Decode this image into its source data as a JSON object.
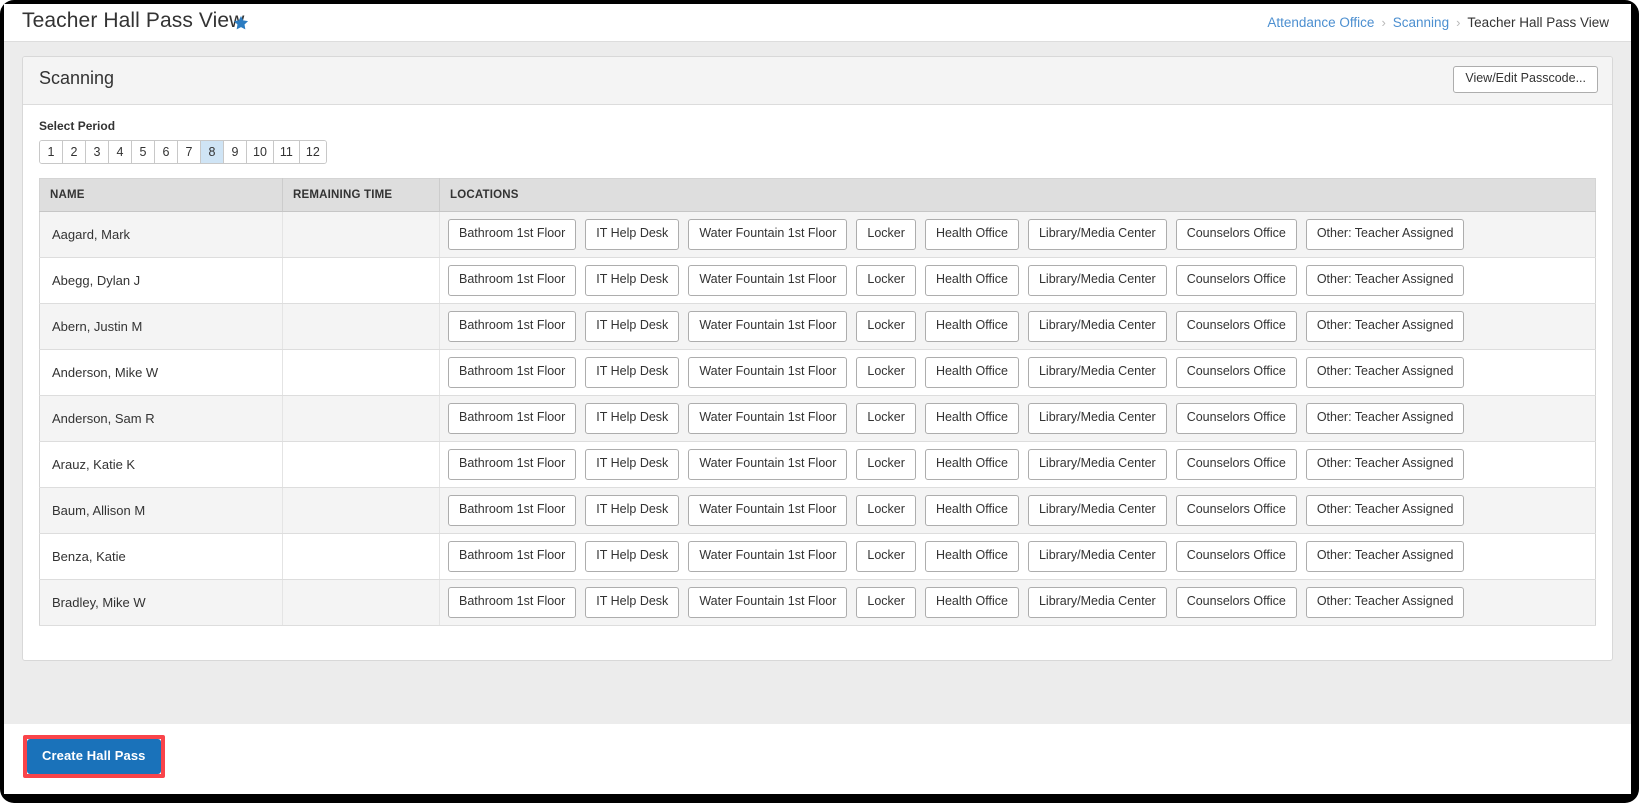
{
  "header": {
    "title": "Teacher Hall Pass View",
    "favorite_icon": "star-icon",
    "star_color": "#2b7cc1"
  },
  "breadcrumb": {
    "items": [
      {
        "label": "Attendance Office",
        "link": true
      },
      {
        "label": "Scanning",
        "link": true
      },
      {
        "label": "Teacher Hall Pass View",
        "link": false
      }
    ],
    "separator": "›"
  },
  "card": {
    "title": "Scanning",
    "passcode_button": "View/Edit Passcode..."
  },
  "period_selector": {
    "label": "Select Period",
    "options": [
      "1",
      "2",
      "3",
      "4",
      "5",
      "6",
      "7",
      "8",
      "9",
      "10",
      "11",
      "12"
    ],
    "selected": "8",
    "selected_color": "#cfe4f5"
  },
  "table": {
    "columns": [
      "NAME",
      "REMAINING TIME",
      "LOCATIONS"
    ],
    "locations": [
      "Bathroom 1st Floor",
      "IT Help Desk",
      "Water Fountain 1st Floor",
      "Locker",
      "Health Office",
      "Library/Media Center",
      "Counselors Office",
      "Other: Teacher Assigned"
    ],
    "rows": [
      {
        "name": "Aagard, Mark",
        "remaining_time": ""
      },
      {
        "name": "Abegg, Dylan J",
        "remaining_time": ""
      },
      {
        "name": "Abern, Justin M",
        "remaining_time": ""
      },
      {
        "name": "Anderson, Mike W",
        "remaining_time": ""
      },
      {
        "name": "Anderson, Sam R",
        "remaining_time": ""
      },
      {
        "name": "Arauz, Katie K",
        "remaining_time": ""
      },
      {
        "name": "Baum, Allison M",
        "remaining_time": ""
      },
      {
        "name": "Benza, Katie",
        "remaining_time": ""
      },
      {
        "name": "Bradley, Mike W",
        "remaining_time": ""
      }
    ]
  },
  "footer": {
    "create_button": "Create Hall Pass",
    "create_button_color": "#1a72ba",
    "highlight_color": "#f9444a"
  }
}
